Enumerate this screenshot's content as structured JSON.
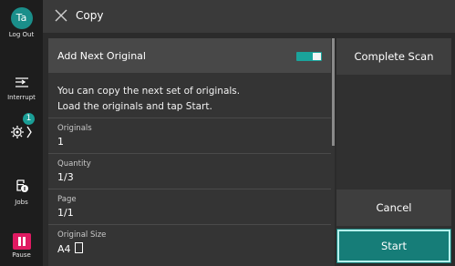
{
  "header": {
    "title": "Copy"
  },
  "sidebar": {
    "avatar_initials": "Ta",
    "log_out_label": "Log Out",
    "interrupt_label": "Interrupt",
    "settings_badge": "1",
    "jobs_label": "Jobs",
    "pause_label": "Pause"
  },
  "main": {
    "next_original_label": "Add Next Original",
    "next_original_enabled": true,
    "message_line1": "You can copy the next set of originals.",
    "message_line2": "Load the originals and tap Start.",
    "rows": [
      {
        "label": "Originals",
        "value": "1"
      },
      {
        "label": "Quantity",
        "value": "1/3"
      },
      {
        "label": "Page",
        "value": "1/1"
      },
      {
        "label": "Original Size",
        "value": "A4"
      }
    ]
  },
  "actions": {
    "complete_scan": "Complete Scan",
    "cancel": "Cancel",
    "start": "Start"
  },
  "colors": {
    "accent": "#1aa39b",
    "start_button": "#167d78",
    "pause": "#e01a62",
    "avatar": "#1a8e8a"
  }
}
